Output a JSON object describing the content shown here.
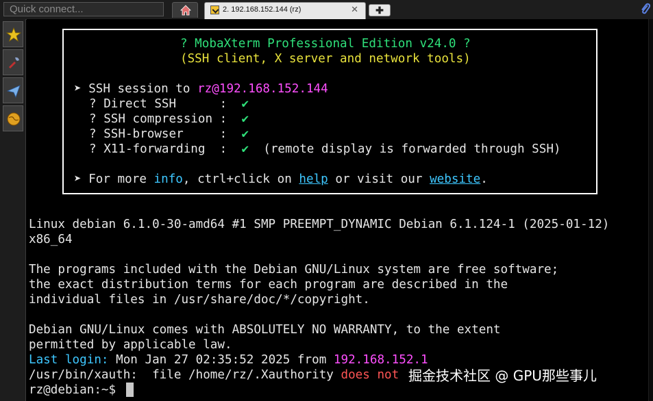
{
  "topbar": {
    "quick_connect_placeholder": "Quick connect...",
    "session_tab_label": "2. 192.168.152.144 (rz)",
    "session_tab_close": "✕",
    "new_tab": "✚"
  },
  "banner": {
    "title": "? MobaXterm Professional Edition v24.0 ?",
    "subtitle": "(SSH client, X server and network tools)",
    "ssh_session": {
      "bullet": "➤",
      "prefix": "SSH session to ",
      "target": "rz@192.168.152.144"
    },
    "features": [
      {
        "q": "?",
        "name": "Direct SSH      ",
        "sep": ":",
        "check": "✔",
        "note": ""
      },
      {
        "q": "?",
        "name": "SSH compression ",
        "sep": ":",
        "check": "✔",
        "note": ""
      },
      {
        "q": "?",
        "name": "SSH-browser     ",
        "sep": ":",
        "check": "✔",
        "note": ""
      },
      {
        "q": "?",
        "name": "X11-forwarding  ",
        "sep": ":",
        "check": "✔",
        "note": "  (remote display is forwarded through SSH)"
      }
    ],
    "more": {
      "bullet": "➤",
      "p1": "For more ",
      "info": "info",
      "p2": ", ctrl+click on ",
      "help": "help",
      "p3": " or visit our ",
      "website": "website",
      "p4": "."
    }
  },
  "terminal": {
    "uname_1": "Linux debian 6.1.0-30-amd64 #1 SMP PREEMPT_DYNAMIC Debian 6.1.124-1 (2025-01-12)",
    "uname_2": "x86_64",
    "motd_1": "The programs included with the Debian GNU/Linux system are free software;",
    "motd_2": "the exact distribution terms for each program are described in the",
    "motd_3": "individual files in /usr/share/doc/*/copyright.",
    "motd_4": "Debian GNU/Linux comes with ABSOLUTELY NO WARRANTY, to the extent",
    "motd_5": "permitted by applicable law.",
    "last_login_label": "Last login:",
    "last_login_time": " Mon Jan 27 02:35:52 2025 from ",
    "last_login_ip": "192.168.152.1",
    "xauth_msg": "/usr/bin/xauth:  file /home/rz/.Xauthority ",
    "xauth_err": "does not",
    "prompt": "rz@debian:~$ "
  },
  "watermark": "掘金技术社区 @ GPU那些事儿",
  "colors": {
    "green": "#2fe07a",
    "yellow": "#e8e23c",
    "magenta": "#ff4fff",
    "cyan": "#3ec7ff",
    "red": "#ff5555"
  },
  "icons": {
    "home": "home-icon",
    "session": "terminal-session-icon",
    "attach": "paperclip-icon",
    "sidebar": [
      "star-icon",
      "tools-icon",
      "send-icon",
      "globe-icon"
    ]
  }
}
